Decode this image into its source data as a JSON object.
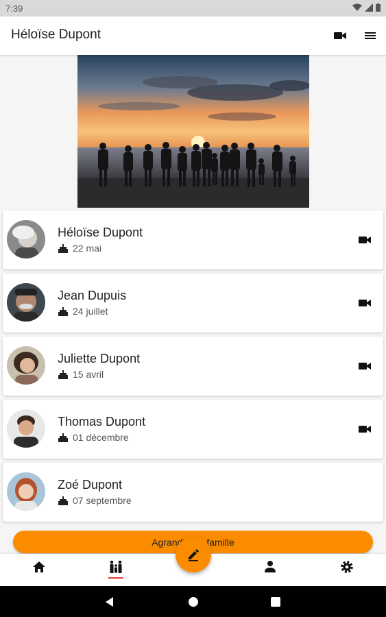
{
  "status_bar": {
    "time": "7:39"
  },
  "app_bar": {
    "title": "Héloïse Dupont"
  },
  "members": [
    {
      "name": "Héloïse Dupont",
      "birthday": "22 mai",
      "has_video": true
    },
    {
      "name": "Jean Dupuis",
      "birthday": "24 juillet",
      "has_video": true
    },
    {
      "name": "Juliette Dupont",
      "birthday": "15 avril",
      "has_video": true
    },
    {
      "name": "Thomas Dupont",
      "birthday": "01 décembre",
      "has_video": true
    },
    {
      "name": "Zoé Dupont",
      "birthday": "07 septembre",
      "has_video": false
    }
  ],
  "cta": {
    "label": "Agrandir ma famille"
  },
  "bottom_nav": {
    "items": [
      "home-icon",
      "family-icon",
      "person-icon",
      "settings-icon"
    ],
    "active": "family-icon"
  },
  "colors": {
    "accent": "#fb8c00",
    "active_underline": "#e53935"
  },
  "icons": {
    "app_bar": [
      "video-camera-icon",
      "menu-icon"
    ],
    "fab": "edit-pencil-icon",
    "card": [
      "birthday-cake-icon",
      "video-camera-icon"
    ]
  }
}
